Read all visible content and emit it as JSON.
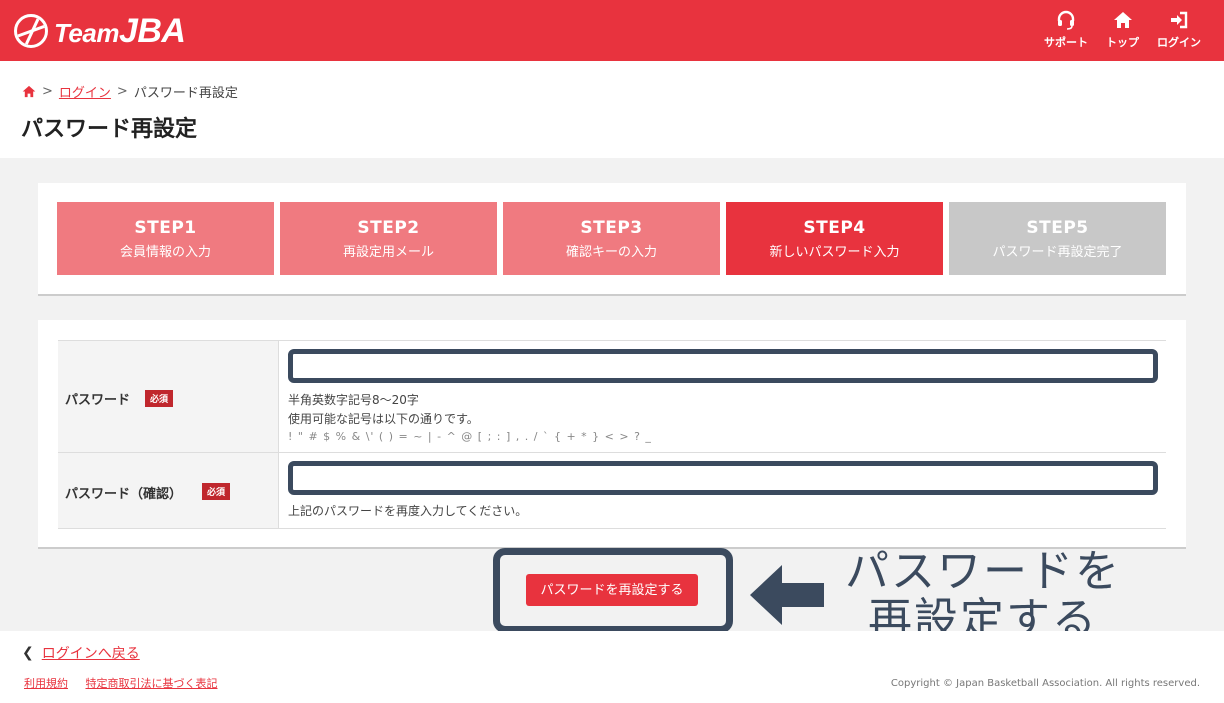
{
  "header": {
    "logo_text_small": "Team",
    "logo_text_big": "JBA",
    "nav": [
      {
        "label": "サポート",
        "icon": "headset-icon"
      },
      {
        "label": "トップ",
        "icon": "home-icon"
      },
      {
        "label": "ログイン",
        "icon": "login-icon"
      }
    ]
  },
  "breadcrumb": {
    "home_icon": "home-icon",
    "sep": ">",
    "login": "ログイン",
    "current": "パスワード再設定"
  },
  "page_title": "パスワード再設定",
  "steps": [
    {
      "title": "STEP1",
      "sub": "会員情報の入力",
      "state": "done"
    },
    {
      "title": "STEP2",
      "sub": "再設定用メール",
      "state": "done"
    },
    {
      "title": "STEP3",
      "sub": "確認キーの入力",
      "state": "done"
    },
    {
      "title": "STEP4",
      "sub": "新しいパスワード入力",
      "state": "active"
    },
    {
      "title": "STEP5",
      "sub": "パスワード再設定完了",
      "state": "todo"
    }
  ],
  "form": {
    "required_badge": "必須",
    "password": {
      "label": "パスワード",
      "value": "",
      "note1": "半角英数字記号8〜20字",
      "note2": "使用可能な記号は以下の通りです。",
      "symbols": "! \" # $ % & \\' ( ) = ~ | - ^ @ [ ; : ] , . / ` { + * } < > ? _"
    },
    "password_confirm": {
      "label": "パスワード（確認）",
      "value": "",
      "note": "上記のパスワードを再度入力してください。"
    }
  },
  "submit_label": "パスワードを再設定する",
  "annotation": {
    "line1": "パスワードを",
    "line2": "再設定する"
  },
  "footer": {
    "back_label": "ログインへ戻る",
    "terms": "利用規約",
    "commerce": "特定商取引法に基づく表記",
    "copyright": "Copyright © Japan Basketball Association. All rights reserved."
  },
  "colors": {
    "brand_red": "#e8333e",
    "step_done": "#f07a80",
    "step_todo": "#c8c8c8",
    "annotation_navy": "#3b4a5e"
  }
}
